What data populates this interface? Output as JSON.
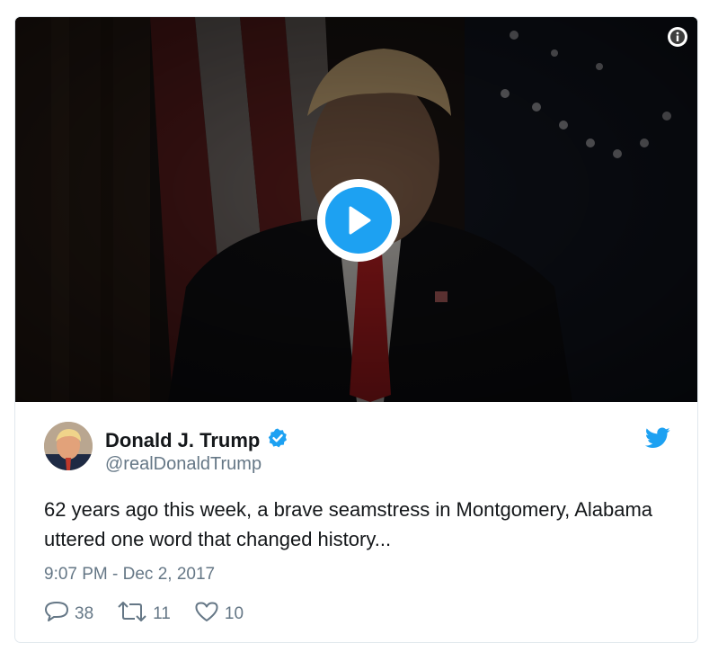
{
  "tweet": {
    "author_name": "Donald J. Trump",
    "handle": "@realDonaldTrump",
    "text": "62 years ago this week, a brave seamstress in Montgomery, Alabama uttered one word that changed history...",
    "timestamp": "9:07 PM - Dec 2, 2017",
    "verified_icon": "verified-badge-icon",
    "platform_icon": "twitter-bird-icon"
  },
  "actions": {
    "replies": "38",
    "retweets": "11",
    "likes": "10"
  },
  "media": {
    "play_icon": "play-icon",
    "info_icon": "info-icon"
  },
  "colors": {
    "accent": "#1da1f2",
    "text": "#14171a",
    "secondary": "#657786"
  }
}
